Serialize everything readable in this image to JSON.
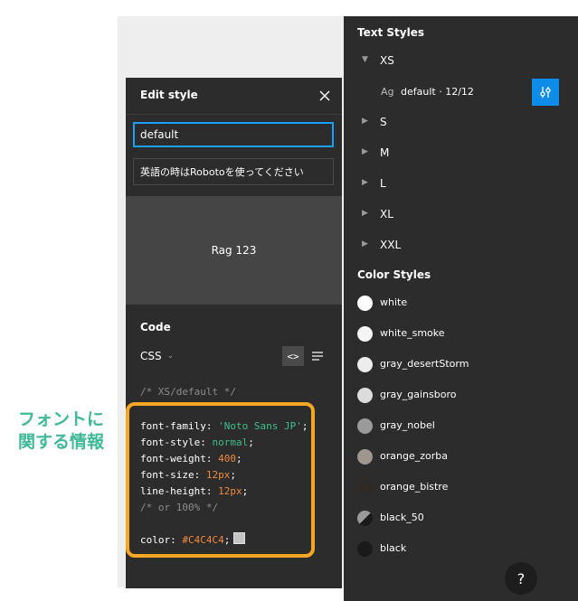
{
  "annotation": {
    "line1": "フォントに",
    "line2": "関する情報"
  },
  "text_styles": {
    "title": "Text Styles",
    "groups": [
      {
        "label": "XS",
        "expanded": true
      },
      {
        "label": "S",
        "expanded": false
      },
      {
        "label": "M",
        "expanded": false
      },
      {
        "label": "L",
        "expanded": false
      },
      {
        "label": "XL",
        "expanded": false
      },
      {
        "label": "XXL",
        "expanded": false
      }
    ],
    "selected_item": {
      "ag": "Ag",
      "name": "default · 12/12"
    }
  },
  "color_styles": {
    "title": "Color Styles",
    "items": [
      {
        "label": "white",
        "color": "#ffffff"
      },
      {
        "label": "white_smoke",
        "color": "#f5f5f5"
      },
      {
        "label": "gray_desertStorm",
        "color": "#ececec"
      },
      {
        "label": "gray_gainsboro",
        "color": "#dcdcdc"
      },
      {
        "label": "gray_nobel",
        "color": "#9a9a9a"
      },
      {
        "label": "orange_zorba",
        "color": "#9e9790"
      },
      {
        "label": "orange_bistre",
        "color": "#2f2a26"
      },
      {
        "label": "black_50",
        "color": "#7f7f7f"
      },
      {
        "label": "black",
        "color": "#1a1a1a"
      }
    ]
  },
  "help_label": "?",
  "edit_style": {
    "title": "Edit style",
    "name_value": "default",
    "description": "英語の時はRobotoを使ってください",
    "preview_text": "Rag 123",
    "code_title": "Code",
    "language": "CSS",
    "code_toggle_label": "<>",
    "comment": "/* XS/default */",
    "code": {
      "font_family_prop": "font-family",
      "font_family_val": "'Noto Sans JP'",
      "font_style_prop": "font-style",
      "font_style_val": "normal",
      "font_weight_prop": "font-weight",
      "font_weight_val": "400",
      "font_size_prop": "font-size",
      "font_size_val": "12px",
      "line_height_prop": "line-height",
      "line_height_val": "12px",
      "line_height_comment": "/* or 100% */",
      "color_prop": "color",
      "color_val": "#C4C4C4"
    }
  },
  "colors": {
    "accent": "#18a0fb",
    "highlight": "#f5a623",
    "annotation": "#3fb998"
  }
}
